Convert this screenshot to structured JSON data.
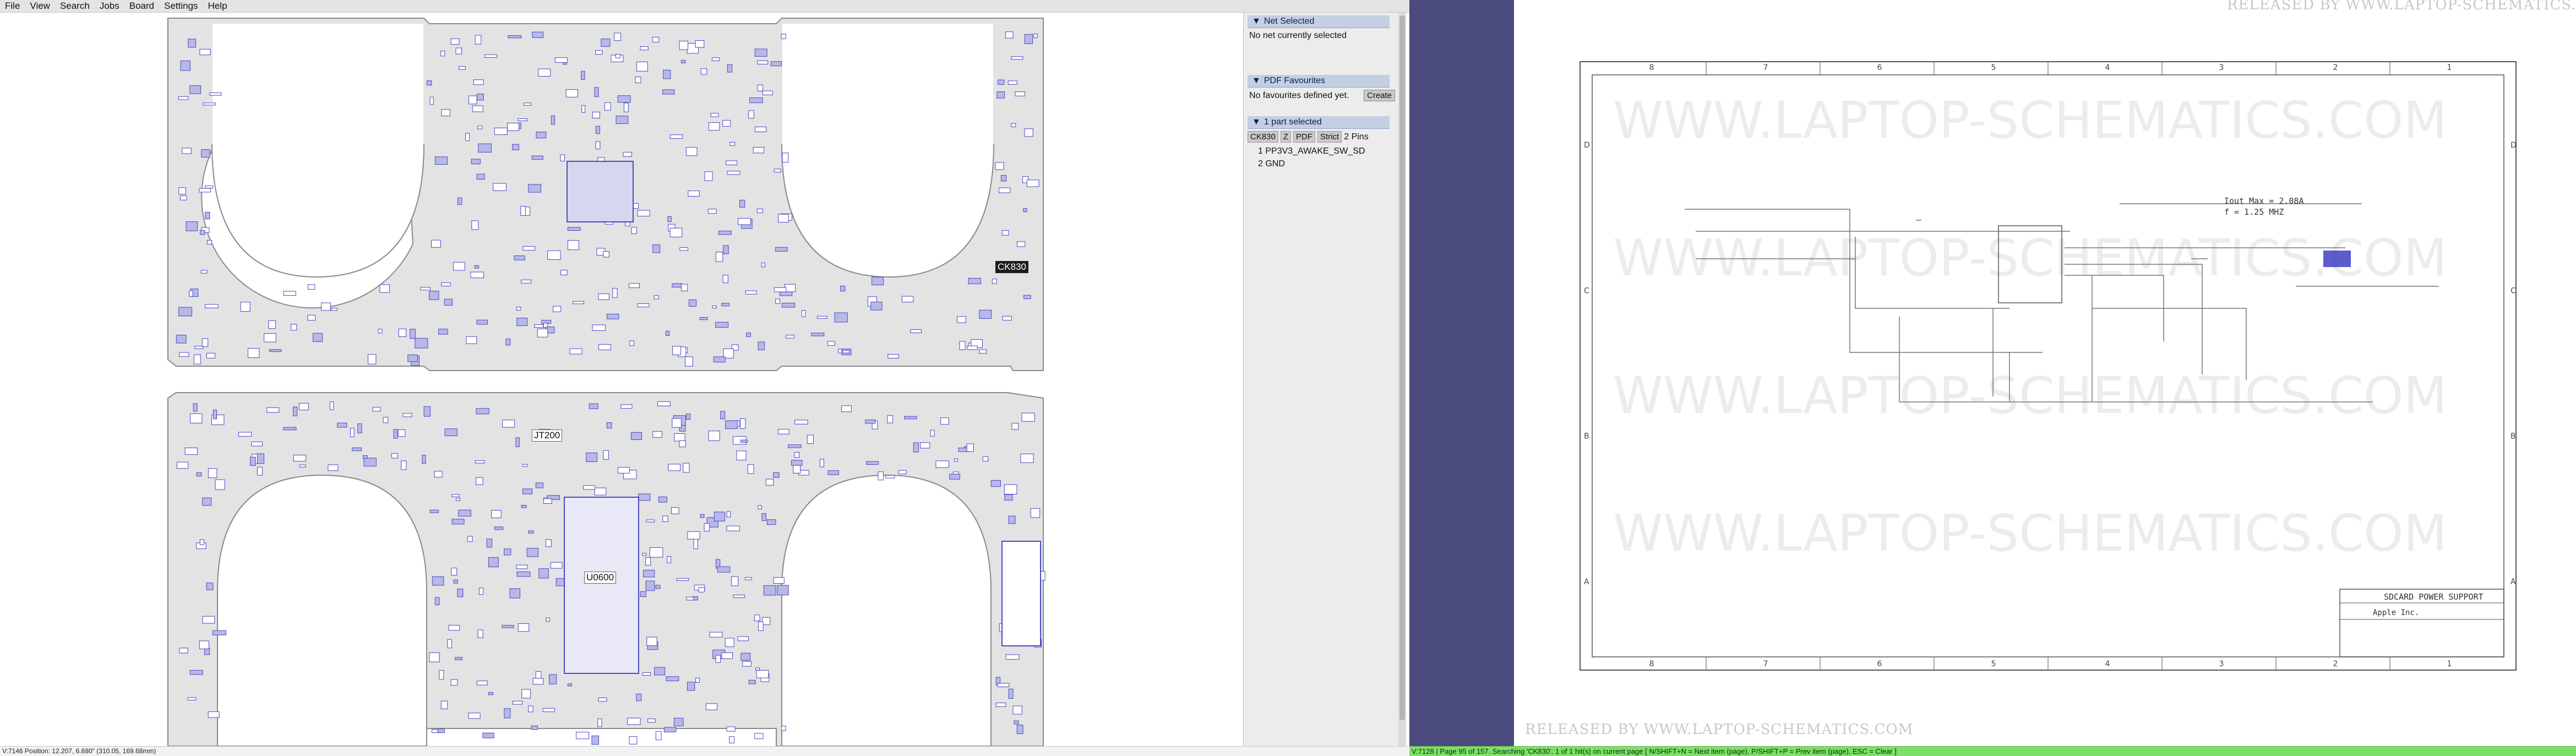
{
  "menu": [
    "File",
    "View",
    "Search",
    "Jobs",
    "Board",
    "Settings",
    "Help"
  ],
  "board": {
    "labels": {
      "ck830": "CK830",
      "jt200": "JT200",
      "u0600": "U0600"
    }
  },
  "panel": {
    "net": {
      "header": "Net Selected",
      "message": "No net currently selected"
    },
    "pdf_fav": {
      "header": "PDF Favourites",
      "message": "No favourites defined yet.",
      "create_label": "Create"
    },
    "parts": {
      "header": "1 part selected",
      "part": "CK830",
      "chips": [
        "Z",
        "PDF",
        "Strict"
      ],
      "pins_label": "2 Pins",
      "pins": [
        "1  PP3V3_AWAKE_SW_SD",
        "2  GND"
      ]
    }
  },
  "pdf": {
    "release_text": "RELEASED  BY  WWW.LAPTOP-SCHEMATICS.COM",
    "watermark": "WWW.LAPTOP-SCHEMATICS.COM",
    "columns": [
      "8",
      "7",
      "6",
      "5",
      "4",
      "3",
      "2",
      "1"
    ],
    "rows": [
      "D",
      "C",
      "B",
      "A"
    ],
    "notes": [
      "Iout Max = 2.08A",
      "f = 1.25 MHZ"
    ],
    "title_block": {
      "title": "SDCARD POWER SUPPORT",
      "company": "Apple Inc."
    }
  },
  "status": {
    "left": "V:7146   Position: 12.207, 6.680\" (310.05, 169.68mm)",
    "right": "V:7128 | Page 95 of 157. Searching 'CK830'. 1 of 1 hit(s) on current page [ N/SHIFT+N = Next item (page), P/SHIFT+P = Prev item (page), ESC = Clear ]"
  },
  "colors": {
    "board_fill": "#e3e3e3",
    "component": "#4a4ac8",
    "panel_header": "#c3cfe2",
    "pdf_strip": "#4b4a7e",
    "status_green": "#7ddf6a"
  }
}
